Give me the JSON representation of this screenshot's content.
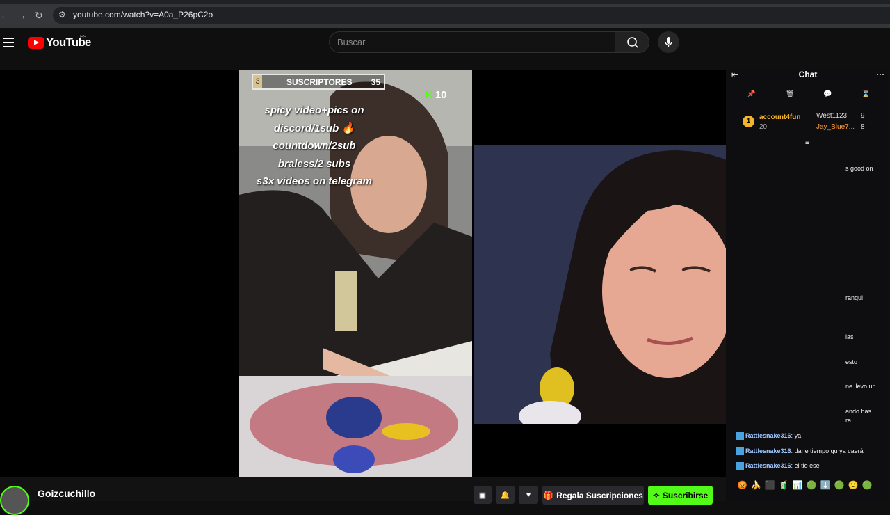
{
  "browser": {
    "url": "youtube.com/watch?v=A0a_P26pC2o",
    "back": "←",
    "forward": "→",
    "reload": "↻"
  },
  "youtube": {
    "logo_text": "YouTube",
    "country_code": "ES",
    "search_placeholder": "Buscar"
  },
  "left_stream": {
    "sub_box_num": "3",
    "sub_box_label": "SUSCRIPTORES",
    "sub_box_count": "35",
    "kick_count": "10",
    "overlay_lines": [
      "spicy video+pics on",
      "discord/1sub 🔥",
      "countdown/2sub",
      "braless/2 subs",
      "s3x videos on telegram"
    ]
  },
  "chat": {
    "title": "Chat",
    "leaderboard": {
      "first_user": "account4fun",
      "first_score": "20",
      "second_user": "West1123",
      "second_score": "9",
      "third_user": "Jay_Blue7...",
      "third_score": "8"
    },
    "partial_lines": [
      "s good on",
      "ranqui",
      "las",
      "esto",
      "ne llevo un",
      "ando has",
      "ra"
    ],
    "messages": [
      {
        "user": "Rattlesnake316",
        "text": "ya"
      },
      {
        "user": "Rattlesnake316",
        "text": "darle tiempo qu ya caerá"
      },
      {
        "user": "Rattlesnake316",
        "text": "el tio ese"
      }
    ],
    "emotes": "😡🍌⬛🧃📊🟢⬇️🟢🙂🟢"
  },
  "channel": {
    "name": "Goizcuchillo",
    "gift_label": "Regala Suscripciones",
    "subscribe_label": "Suscribirse"
  }
}
